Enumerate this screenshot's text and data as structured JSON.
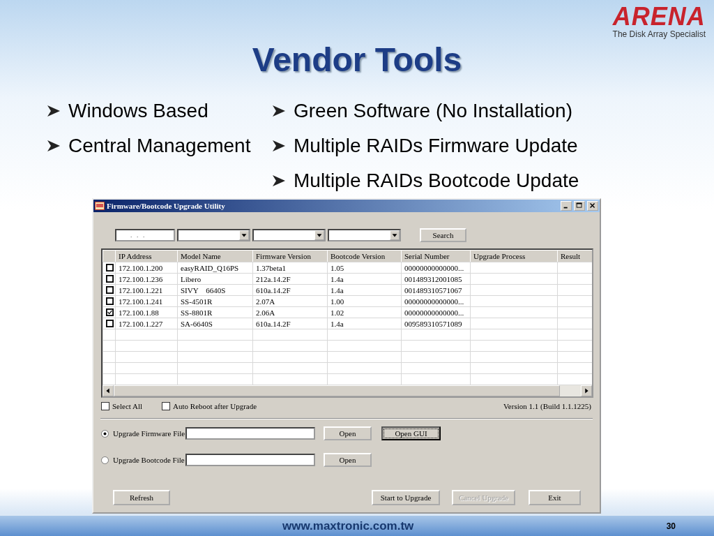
{
  "logo": {
    "name": "ARENA",
    "tagline": "The Disk Array Specialist"
  },
  "title": "Vendor Tools",
  "bullets_left": [
    "Windows Based",
    "Central Management"
  ],
  "bullets_right": [
    "Green Software (No Installation)",
    "Multiple RAIDs Firmware Update",
    "Multiple RAIDs Bootcode Update"
  ],
  "window": {
    "title": "Firmware/Bootcode Upgrade Utility",
    "ip_field": {
      "value": ".   .   ."
    },
    "search_button": "Search",
    "table": {
      "columns": [
        "IP Address",
        "Model Name",
        "Firmware Version",
        "Bootcode Version",
        "Serial Number",
        "Upgrade Process",
        "Result"
      ],
      "rows": [
        {
          "checked": false,
          "cells": [
            "172.100.1.200",
            "easyRAID_Q16PS",
            "1.37beta1",
            "1.05",
            "00000000000000..."
          ]
        },
        {
          "checked": false,
          "cells": [
            "172.100.1.236",
            "Libero",
            "212a.14.2F",
            "1.4a",
            "001489312001085"
          ]
        },
        {
          "checked": false,
          "cells": [
            "172.100.1.221",
            "SIVY    6640S",
            "610a.14.2F",
            "1.4a",
            "001489310571067"
          ]
        },
        {
          "checked": false,
          "cells": [
            "172.100.1.241",
            "SS-4501R",
            "2.07A",
            "1.00",
            "00000000000000..."
          ]
        },
        {
          "checked": true,
          "cells": [
            "172.100.1.88",
            "SS-8801R",
            "2.06A",
            "1.02",
            "00000000000000..."
          ]
        },
        {
          "checked": false,
          "cells": [
            "172.100.1.227",
            "SA-6640S",
            "610a.14.2F",
            "1.4a",
            "009589310571089"
          ]
        }
      ]
    },
    "options": [
      {
        "label": "Select All",
        "checked": false
      },
      {
        "label": "Auto Reboot after Upgrade",
        "checked": false
      }
    ],
    "version": "Version 1.1 (Build 1.1.1225)",
    "file_rows": [
      {
        "label": "Upgrade Firmware File",
        "selected": true,
        "buttons": [
          {
            "label": "Open",
            "focused": false
          },
          {
            "label": "Open GUI",
            "focused": true
          }
        ]
      },
      {
        "label": "Upgrade Bootcode File",
        "selected": false,
        "buttons": [
          {
            "label": "Open",
            "focused": false
          }
        ]
      }
    ],
    "bottom_buttons": [
      {
        "label": "Refresh",
        "disabled": false
      },
      {
        "label": "Start to Upgrade",
        "disabled": false
      },
      {
        "label": "Cancel Upgrade",
        "disabled": true
      },
      {
        "label": "Exit",
        "disabled": false
      }
    ]
  },
  "footer": {
    "url": "www.maxtronic.com.tw",
    "page": "30"
  }
}
